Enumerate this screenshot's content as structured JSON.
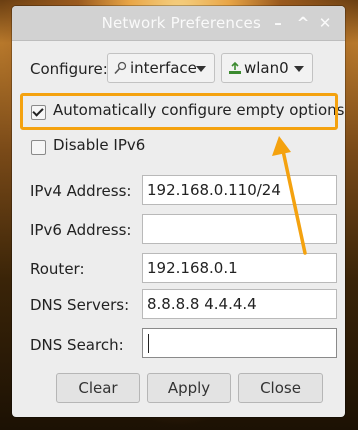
{
  "window": {
    "title": "Network Preferences",
    "minimize": "–",
    "maximize": "^",
    "close": "✕"
  },
  "configure": {
    "label": "Configure:",
    "type_value": "interface",
    "type_icon": "network-icon",
    "interface_value": "wlan0",
    "interface_icon": "wireless-icon"
  },
  "options": {
    "auto_configure_label": "Automatically configure empty options",
    "auto_configure_checked": true,
    "disable_ipv6_label": "Disable IPv6",
    "disable_ipv6_checked": false
  },
  "fields": {
    "ipv4_label": "IPv4 Address:",
    "ipv4_value": "192.168.0.110/24",
    "ipv6_label": "IPv6 Address:",
    "ipv6_value": "",
    "router_label": "Router:",
    "router_value": "192.168.0.1",
    "dns_servers_label": "DNS Servers:",
    "dns_servers_value": "8.8.8.8 4.4.4.4",
    "dns_search_label": "DNS Search:",
    "dns_search_value": ""
  },
  "buttons": {
    "clear": "Clear",
    "apply": "Apply",
    "close": "Close"
  },
  "colors": {
    "highlight": "#f4a20f",
    "window_bg": "#ededed",
    "titlebar_bg": "#d2d2d2"
  }
}
